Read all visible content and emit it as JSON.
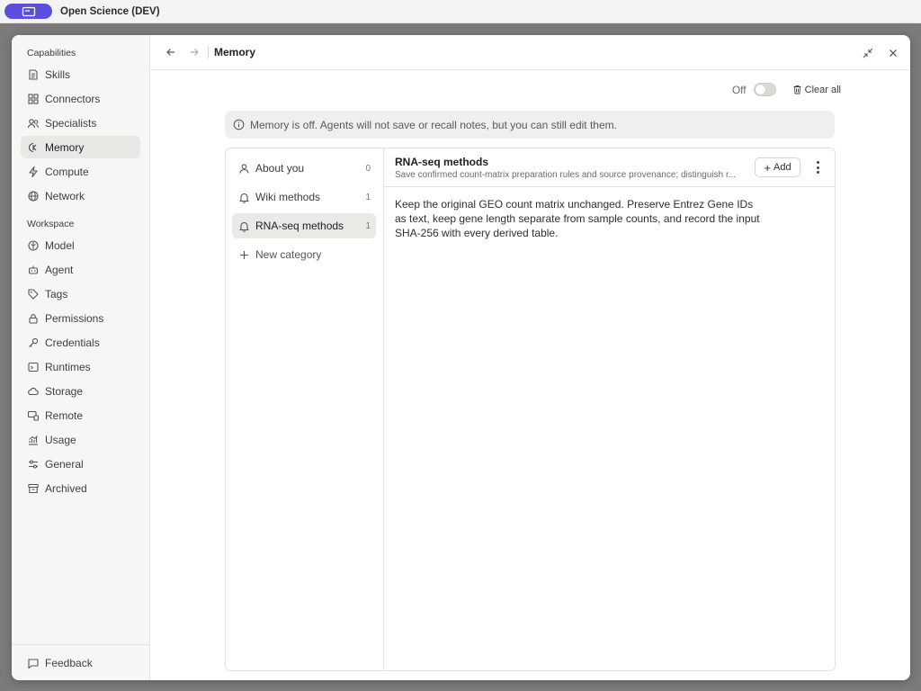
{
  "app": {
    "title": "Open Science (DEV)"
  },
  "sidebar": {
    "capabilities_title": "Capabilities",
    "capabilities": [
      {
        "label": "Skills",
        "icon": "skills-icon"
      },
      {
        "label": "Connectors",
        "icon": "connectors-icon"
      },
      {
        "label": "Specialists",
        "icon": "specialists-icon"
      },
      {
        "label": "Memory",
        "icon": "memory-icon",
        "active": true
      },
      {
        "label": "Compute",
        "icon": "compute-icon"
      },
      {
        "label": "Network",
        "icon": "network-icon"
      }
    ],
    "workspace_title": "Workspace",
    "workspace": [
      {
        "label": "Model",
        "icon": "model-icon"
      },
      {
        "label": "Agent",
        "icon": "agent-icon"
      },
      {
        "label": "Tags",
        "icon": "tags-icon"
      },
      {
        "label": "Permissions",
        "icon": "lock-icon"
      },
      {
        "label": "Credentials",
        "icon": "key-icon"
      },
      {
        "label": "Runtimes",
        "icon": "terminal-icon"
      },
      {
        "label": "Storage",
        "icon": "cloud-icon"
      },
      {
        "label": "Remote",
        "icon": "remote-icon"
      },
      {
        "label": "Usage",
        "icon": "usage-icon"
      },
      {
        "label": "General",
        "icon": "sliders-icon"
      },
      {
        "label": "Archived",
        "icon": "archive-icon"
      }
    ],
    "feedback": "Feedback"
  },
  "header": {
    "title": "Memory"
  },
  "toolbar": {
    "toggle_label": "Off",
    "toggle_state": "off",
    "clear_label": "Clear all"
  },
  "banner": {
    "text": "Memory is off. Agents will not save or recall notes, but you can still edit them."
  },
  "categories": [
    {
      "label": "About you",
      "count": "0",
      "icon": "user-icon"
    },
    {
      "label": "Wiki methods",
      "count": "1",
      "icon": "bell-icon"
    },
    {
      "label": "RNA-seq methods",
      "count": "1",
      "icon": "bell-icon",
      "active": true
    }
  ],
  "new_category": "New category",
  "note": {
    "title": "RNA-seq methods",
    "subtitle": "Save confirmed count-matrix preparation rules and source provenance; distinguish r...",
    "add_label": "Add",
    "body": "Keep the original GEO count matrix unchanged. Preserve Entrez Gene IDs as text, keep gene length separate from sample counts, and record the input SHA-256 with every derived table."
  },
  "colors": {
    "accent": "#5b4fe0",
    "sidebar_bg": "#f6f6f4",
    "active_bg": "#e8e8e5",
    "banner_bg": "#efefed"
  }
}
